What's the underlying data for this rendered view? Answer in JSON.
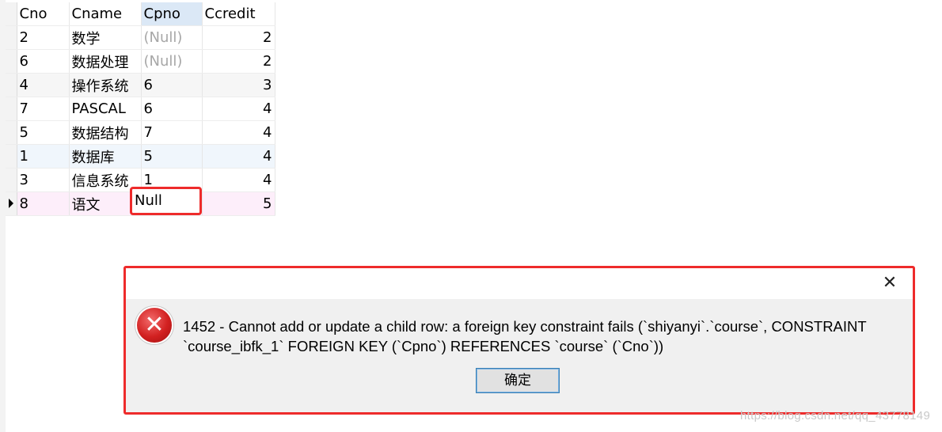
{
  "table": {
    "columns": [
      "Cno",
      "Cname",
      "Cpno",
      "Ccredit"
    ],
    "rows": [
      {
        "Cno": "2",
        "Cname": "数学",
        "Cpno": "(Null)",
        "Ccredit": "2"
      },
      {
        "Cno": "6",
        "Cname": "数据处理",
        "Cpno": "(Null)",
        "Ccredit": "2"
      },
      {
        "Cno": "4",
        "Cname": "操作系统",
        "Cpno": "6",
        "Ccredit": "3"
      },
      {
        "Cno": "7",
        "Cname": "PASCAL",
        "Cpno": "6",
        "Ccredit": "4"
      },
      {
        "Cno": "5",
        "Cname": "数据结构",
        "Cpno": "7",
        "Ccredit": "4"
      },
      {
        "Cno": "1",
        "Cname": "数据库",
        "Cpno": "5",
        "Ccredit": "4"
      },
      {
        "Cno": "3",
        "Cname": "信息系统",
        "Cpno": "1",
        "Ccredit": "4"
      },
      {
        "Cno": "8",
        "Cname": "语文",
        "Cpno": "Null",
        "Ccredit": "5"
      }
    ]
  },
  "dialog": {
    "close_glyph": "✕",
    "icon_glyph": "✕",
    "message": "1452 - Cannot add or update a child row: a foreign key constraint fails (`shiyanyi`.`course`, CONSTRAINT `course_ibfk_1` FOREIGN KEY (`Cpno`) REFERENCES `course` (`Cno`))",
    "ok_label": "确定"
  },
  "watermark": "https://blog.csdn.net/qq_43778149",
  "colors": {
    "highlight_border": "#ee2b2b",
    "null_text": "#a7a7a7",
    "selected_header": "#dbe8f6"
  }
}
